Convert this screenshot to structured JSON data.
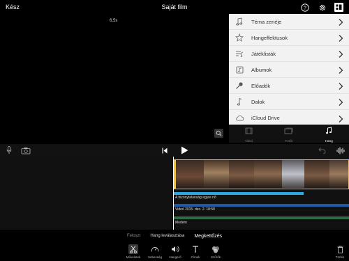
{
  "header": {
    "done_label": "Kész",
    "title": "Saját film"
  },
  "preview": {
    "timecode": "6,5s"
  },
  "browser": {
    "items": [
      {
        "label": "Téma zenéje",
        "icon": "music-note-icon"
      },
      {
        "label": "Hangeffektusok",
        "icon": "sparkle-icon"
      },
      {
        "label": "Játéklisták",
        "icon": "playlist-icon"
      },
      {
        "label": "Albumok",
        "icon": "album-icon"
      },
      {
        "label": "Előadók",
        "icon": "microphone-icon"
      },
      {
        "label": "Dalok",
        "icon": "music-note-icon"
      },
      {
        "label": "iCloud Drive",
        "icon": "cloud-icon"
      }
    ],
    "tabs": [
      {
        "label": "Videó",
        "icon": "film-icon"
      },
      {
        "label": "Fotók",
        "icon": "photos-icon"
      },
      {
        "label": "Hang",
        "icon": "music-note-icon"
      }
    ]
  },
  "timeline": {
    "audio_label": "A bizonytalanság egyre nő",
    "date_label": "Videó 2015. dec. 2. 18:58",
    "theme_label": "Modern"
  },
  "actions": {
    "split": "Feloszt",
    "detach": "Hang leválasztása",
    "duplicate": "Megkettőzés"
  },
  "tools": [
    {
      "label": "Műveletek",
      "icon": "scissors-icon"
    },
    {
      "label": "Sebesség",
      "icon": "speedometer-icon"
    },
    {
      "label": "Hangerő",
      "icon": "volume-icon"
    },
    {
      "label": "Címek",
      "icon": "title-icon"
    },
    {
      "label": "Szűrők",
      "icon": "filters-icon"
    }
  ],
  "delete_label": "Törlés",
  "colors": {
    "clip_border": "#f5c518",
    "audio_bar": "#2ea8e0",
    "date_bar": "#1e5aa8",
    "theme_bar": "#2f6b45",
    "browser_bg": "#f2f2f2"
  }
}
